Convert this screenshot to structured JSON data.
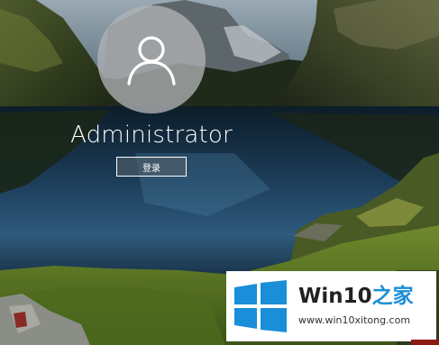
{
  "login": {
    "username": "Administrator",
    "signin_label": "登录"
  },
  "watermark": {
    "brand": "Win10",
    "suffix": "之家",
    "url": "www.win10xitong.com"
  },
  "icons": {
    "avatar": "user-icon",
    "logo": "windows-logo"
  },
  "colors": {
    "logo_blue": "#1a8ed9",
    "button_border": "#ffffff"
  }
}
